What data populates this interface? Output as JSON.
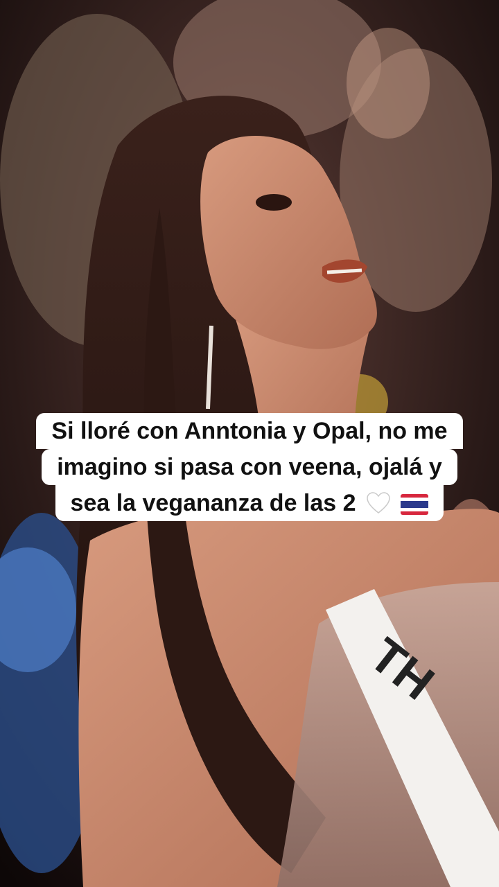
{
  "video": {
    "description_free": true,
    "sash_text": "TH"
  },
  "caption": {
    "lines": [
      "Si lloré con Anntonia y Opal, no me",
      "imagino si pasa con veena, ojalá y",
      "sea la vegananza de las 2"
    ],
    "emoji": [
      "white-heart-icon",
      "thailand-flag-icon"
    ]
  },
  "colors": {
    "caption_bg": "#ffffff",
    "caption_text": "#111111"
  }
}
